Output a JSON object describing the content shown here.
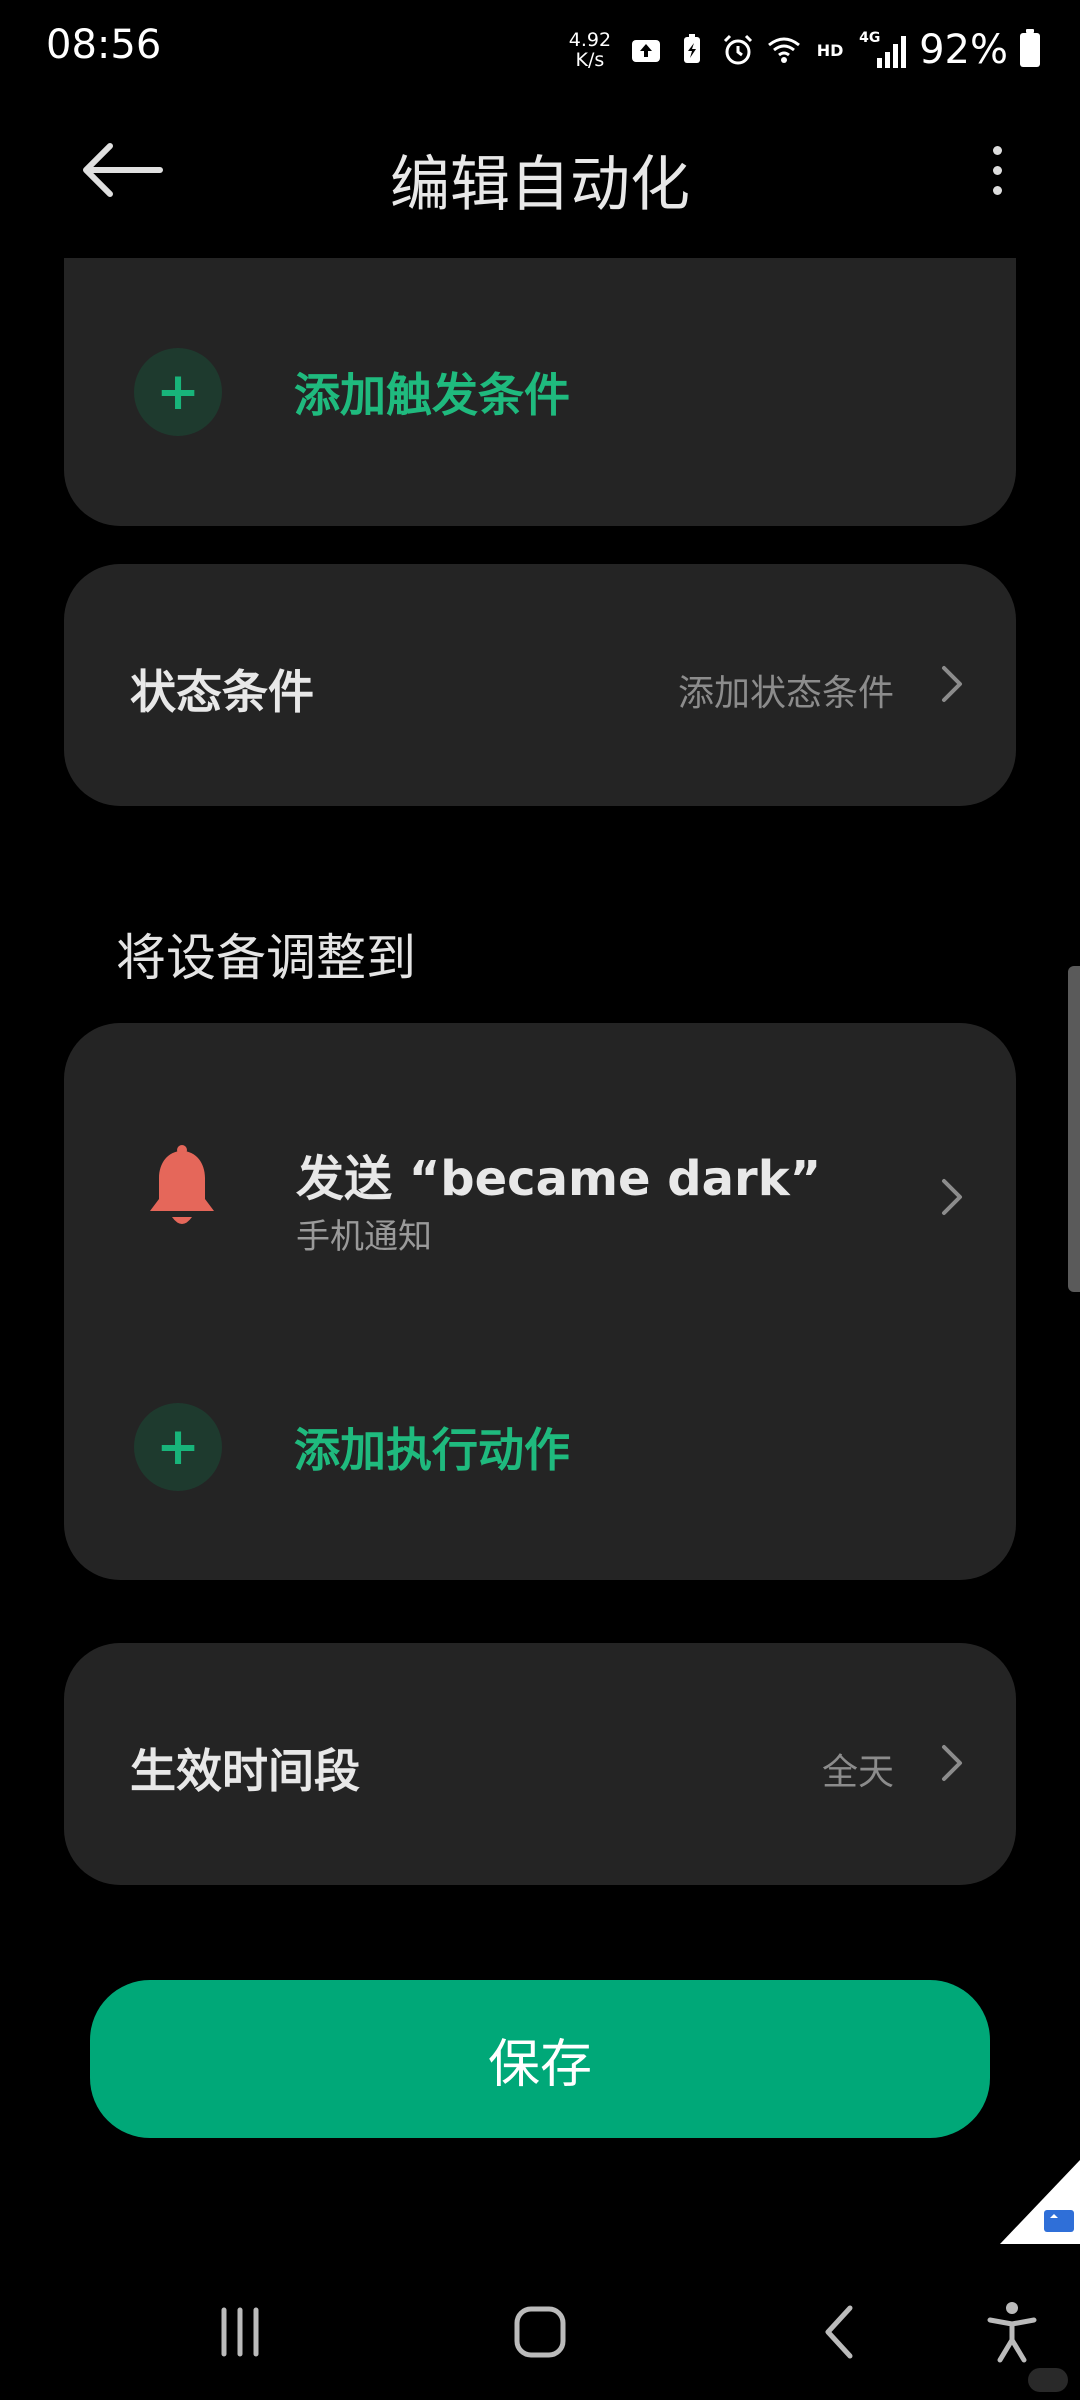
{
  "status_bar": {
    "time": "08:56",
    "net_speed_value": "4.92",
    "net_speed_unit": "K/s",
    "hd_label": "HD",
    "network_label": "4G",
    "battery_percent": "92%",
    "icons": [
      "upload-icon",
      "battery-saver-icon",
      "alarm-icon",
      "wifi-icon",
      "signal-icon",
      "battery-icon"
    ]
  },
  "appbar": {
    "title": "编辑自动化",
    "back_icon": "arrow-left-icon",
    "more_icon": "more-vertical-icon"
  },
  "trigger_card": {
    "add_icon": "plus-icon",
    "add_label": "添加触发条件"
  },
  "state_card": {
    "title": "状态条件",
    "value": "添加状态条件"
  },
  "actions_section": {
    "heading": "将设备调整到",
    "items": [
      {
        "icon": "bell-icon",
        "title": "发送 “became dark”",
        "subtitle": "手机通知"
      }
    ],
    "add_label": "添加执行动作"
  },
  "period_card": {
    "title": "生效时间段",
    "value": "全天"
  },
  "save_button": {
    "label": "保存"
  },
  "colors": {
    "background": "#000000",
    "card": "#242424",
    "accent": "#00a878",
    "accent_text": "#1fba7e",
    "bell": "#e5675a"
  },
  "navbar": {
    "icons": [
      "recents-icon",
      "home-icon",
      "back-icon",
      "accessibility-icon"
    ]
  }
}
